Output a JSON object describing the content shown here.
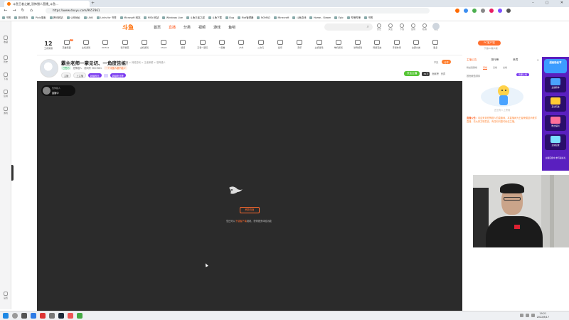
{
  "browser": {
    "tab_title": "斗鱼王者之巅_恐怖猎人直播_斗鱼…",
    "url": "https://www.douyu.com/9657861",
    "bookmarks": [
      "书签",
      "新标签页",
      "Pixiv搜索",
      "腾讯网站",
      "公网地址",
      "LINK",
      "Links for 书签",
      "Microsoft 网站",
      "MSN 网站",
      "Windows Live",
      "斗鱼王者之巅",
      "斗鱼下载",
      "Bug",
      "Riot管理器",
      "NOMAD",
      "Minecraft",
      "斗鱼游戏",
      "Home - Steam",
      "Epic",
      "哔哩哔哩",
      "书签"
    ],
    "edge_side": [
      "收藏",
      "历史",
      "下载",
      "应用",
      "游戏",
      "设置"
    ]
  },
  "site": {
    "logo": "斗鱼",
    "nav": [
      "首页",
      "直播",
      "分类",
      "视频",
      "游戏",
      "鱼吧"
    ],
    "nav_active": 1,
    "header_icons": [
      "历史",
      "关注",
      "下载",
      "签到",
      "私信",
      "消息"
    ]
  },
  "categories": {
    "first_num": "12",
    "first_label": "王者荣耀",
    "items": [
      {
        "label": "英雄联盟",
        "badge": "20"
      },
      {
        "label": "主机游戏",
        "badge": ""
      },
      {
        "label": "DOTA2",
        "badge": ""
      },
      {
        "label": "和平精英",
        "badge": ""
      },
      {
        "label": "主机游戏",
        "badge": ""
      },
      {
        "label": "CSGO",
        "badge": ""
      },
      {
        "label": "颜值",
        "badge": ""
      },
      {
        "label": "王者一起玩",
        "badge": ""
      },
      {
        "label": "一起看",
        "badge": ""
      },
      {
        "label": "户外",
        "badge": ""
      },
      {
        "label": "二次元",
        "badge": ""
      },
      {
        "label": "鱼乐",
        "badge": ""
      },
      {
        "label": "音乐",
        "badge": ""
      },
      {
        "label": "主机游戏",
        "badge": ""
      },
      {
        "label": "单机游戏",
        "badge": ""
      },
      {
        "label": "暴雪游戏",
        "badge": ""
      },
      {
        "label": "网游竞技",
        "badge": ""
      },
      {
        "label": "手游休闲",
        "badge": ""
      },
      {
        "label": "全部分类",
        "badge": ""
      },
      {
        "label": "更多",
        "badge": ""
      }
    ],
    "pc_button": "PC客户端",
    "pc_sub": "下载PC客户端"
  },
  "room": {
    "title": "霸主老师一掌见切、一角度告练！",
    "crumbs": "斗鱼 > 网络游戏 > 王者荣耀 > 恐怖猎人",
    "tag": "已签约",
    "anchor_name": "恐怖猎人",
    "room_id": "房间号 9657861",
    "tag2": "一个中国人都不能少",
    "pill_report": "举报",
    "pill_share": "分享",
    "follow": "关注主播",
    "follow_count": "34万",
    "pill_ext1": "贡献榜",
    "pill_ext2": "贵宾",
    "under1": "主播",
    "under2": "上主播",
    "under3": "超级粉丝",
    "under4": "超级粉丝榜"
  },
  "player": {
    "badge_top": "恐怖猎人",
    "badge_name": "恐怖猎人",
    "refresh": "刷新页面",
    "msg_pre": "您还可以",
    "msg_hl": "下载客户端",
    "msg_post": "观看，获得更多体验功能",
    "badge_level": "直播中"
  },
  "rightpanel": {
    "tabs": [
      "主播公告",
      "排行榜",
      "贵宾"
    ],
    "sub": [
      "粉丝贡献榜",
      "周榜",
      "日榜",
      "总榜"
    ],
    "sort": "按贡献值排序",
    "pill": "我要上榜",
    "empty": "还没有人上榜哦",
    "notice_label": "直播公告：",
    "notice": "欢迎来到恐怖猎人的直播间，本直播间为王者荣耀技术教学直播，请大家文明发言，有任何问题可私信主播。"
  },
  "promo": {
    "title": "超级粉丝节",
    "cards": [
      "主播榜单",
      "互动玩法",
      "粉丝福利",
      "主播应援"
    ],
    "bottom": "主播应援中 参与赢好礼"
  },
  "taskbar": {
    "time": "19:21",
    "date": "2022/8/17"
  }
}
